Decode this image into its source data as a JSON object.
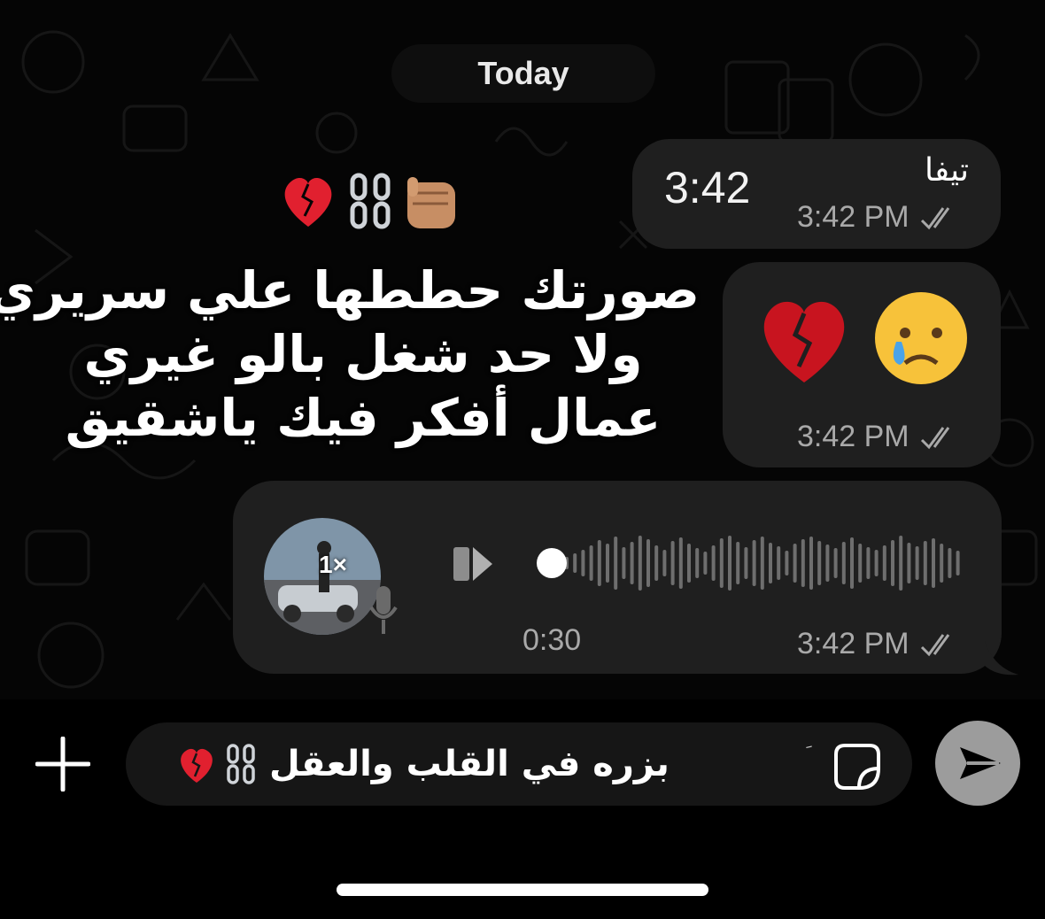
{
  "header": {
    "date_label": "Today"
  },
  "messages": [
    {
      "sender": "تيفا",
      "text": "3:42",
      "time": "3:42 PM",
      "status": "read"
    },
    {
      "emojis": [
        "crying-face",
        "broken-heart"
      ],
      "time": "3:42 PM",
      "status": "read"
    },
    {
      "type": "voice",
      "duration": "0:30",
      "speed": "1×",
      "time": "3:42 PM",
      "status": "read",
      "progress": 0.0
    }
  ],
  "overlay": {
    "emojis": [
      "broken-heart",
      "chains",
      "raised-fist"
    ],
    "lines": [
      "صورتك حططها علي سريري",
      "ولا حد شغل بالو غيري",
      "عمال أفكر فيك ياشقيق"
    ]
  },
  "composer": {
    "input_value": "بزره في القلب والعقل",
    "input_emojis": [
      "broken-heart",
      "chains"
    ],
    "cursor_mark": "َ",
    "icons": {
      "add": "plus-icon",
      "sticker": "sticker-icon",
      "send": "send-icon"
    }
  },
  "colors": {
    "background": "#050505",
    "bubble": "#1f1f1f",
    "meta_text": "#a9a9a9",
    "send_button": "#9c9c9c"
  }
}
